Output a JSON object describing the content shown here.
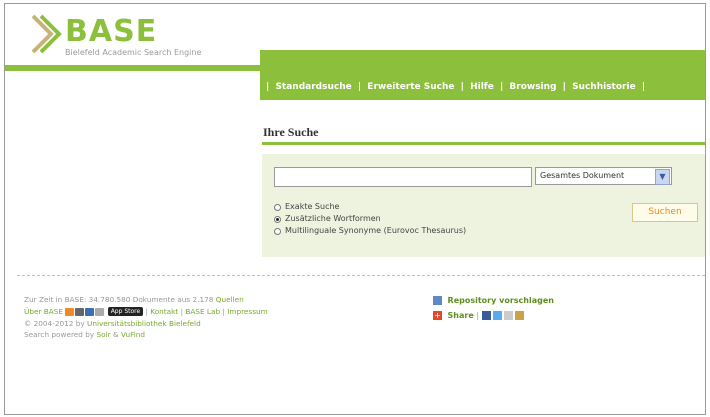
{
  "logo": {
    "name": "BASE",
    "subtitle": "Bielefeld Academic Search Engine",
    "color": "#8cbf3c"
  },
  "nav": {
    "items": [
      "Standardsuche",
      "Erweiterte Suche",
      "Hilfe",
      "Browsing",
      "Suchhistorie"
    ],
    "separator": "|"
  },
  "search": {
    "title": "Ihre Suche",
    "query_value": "",
    "scope_selected": "Gesamtes Dokument",
    "options": [
      {
        "label": "Exakte Suche",
        "selected": false
      },
      {
        "label": "Zusätzliche Wortformen",
        "selected": true
      },
      {
        "label": "Multilinguale Synonyme (Eurovoc Thesaurus)",
        "selected": false
      }
    ],
    "button_label": "Suchen"
  },
  "footer": {
    "stats_prefix": "Zur Zeit in BASE: 34.780.580 Dokumente aus 2.178",
    "stats_link": "Quellen",
    "about_link": "Über BASE",
    "appstore_label": "App Store",
    "links": [
      "Kontakt",
      "BASE Lab",
      "Impressum"
    ],
    "copyright_prefix": "© 2004-2012 by",
    "copyright_link": "Universitätsbibliothek Bielefeld",
    "powered_prefix": "Search powered by",
    "powered_solr": "Solr",
    "powered_amp": "&",
    "powered_vufind": "VuFind",
    "repo_label": "Repository vorschlagen",
    "share_label": "Share"
  },
  "colors": {
    "accent": "#8cbf3c",
    "panel": "#eef3df",
    "button_text": "#e88c1e",
    "link": "#79a92b"
  }
}
